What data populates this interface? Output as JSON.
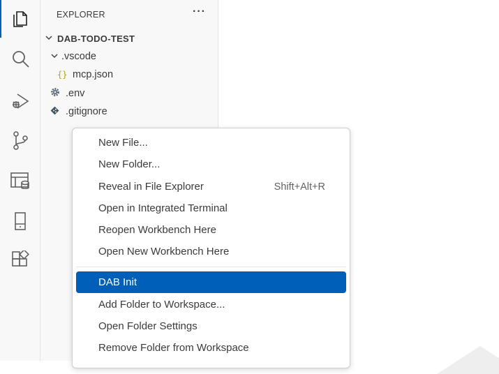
{
  "activity_bar": {
    "icons": [
      "explorer-icon",
      "search-icon",
      "run-debug-icon",
      "source-control-icon",
      "database-icon",
      "remote-icon",
      "extensions-icon"
    ]
  },
  "explorer": {
    "title": "EXPLORER",
    "more": "···",
    "root": "DAB-TODO-TEST",
    "items": [
      {
        "label": ".vscode"
      },
      {
        "label": "mcp.json"
      },
      {
        "label": ".env"
      },
      {
        "label": ".gitignore"
      }
    ]
  },
  "context_menu": {
    "items": [
      {
        "label": "New File..."
      },
      {
        "label": "New Folder..."
      },
      {
        "label": "Reveal in File Explorer",
        "shortcut": "Shift+Alt+R"
      },
      {
        "label": "Open in Integrated Terminal"
      },
      {
        "label": "Reopen Workbench Here"
      },
      {
        "label": "Open New Workbench Here"
      },
      {
        "label": "DAB Init"
      },
      {
        "label": "Add Folder to Workspace..."
      },
      {
        "label": "Open Folder Settings"
      },
      {
        "label": "Remove Folder from Workspace"
      }
    ]
  },
  "colors": {
    "accent": "#005fb8",
    "json_icon": "#b5a500",
    "sidebar_bg": "#f8f8f8"
  }
}
